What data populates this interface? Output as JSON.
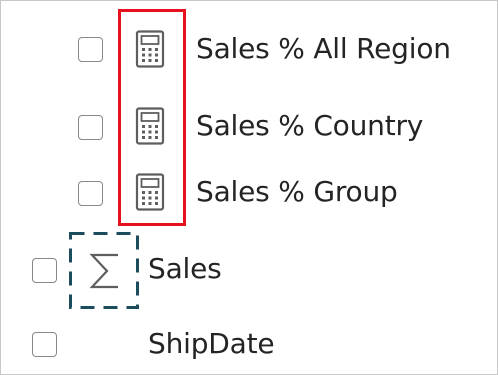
{
  "fields": [
    {
      "name": "Sales % All Region",
      "icon": "calculator-icon",
      "checked": false
    },
    {
      "name": "Sales % Country",
      "icon": "calculator-icon",
      "checked": false
    },
    {
      "name": "Sales % Group",
      "icon": "calculator-icon",
      "checked": false
    },
    {
      "name": "Sales",
      "icon": "sigma-icon",
      "checked": false
    },
    {
      "name": "ShipDate",
      "icon": "",
      "checked": false
    }
  ],
  "colors": {
    "text": "#252423",
    "checkbox_border": "#8a8886",
    "icon": "#605e5c",
    "highlight_red": "#e8101e",
    "highlight_dashed": "#1b4d5c"
  }
}
